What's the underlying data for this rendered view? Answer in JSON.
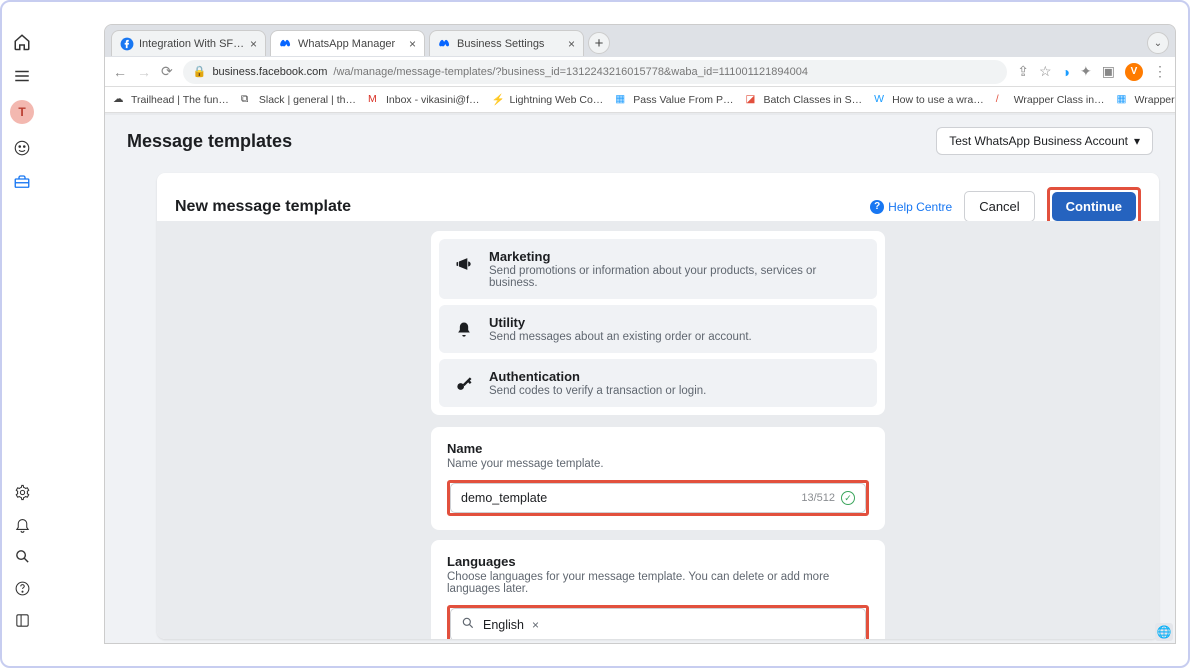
{
  "browser": {
    "tabs": [
      {
        "label": "Integration With SF - WhatsAp…"
      },
      {
        "label": "WhatsApp Manager"
      },
      {
        "label": "Business Settings"
      }
    ],
    "url_prefix": "business.facebook.com",
    "url_path": "/wa/manage/message-templates/?business_id=1312243216015778&waba_id=111001121894004",
    "avatar_letter": "V"
  },
  "bookmarks": [
    {
      "label": "Trailhead | The fun…"
    },
    {
      "label": "Slack | general | th…"
    },
    {
      "label": "Inbox - vikasini@f…"
    },
    {
      "label": "Lightning Web Co…"
    },
    {
      "label": "Pass Value From P…"
    },
    {
      "label": "Batch Classes in S…"
    },
    {
      "label": "How to use a wra…"
    },
    {
      "label": "Wrapper Class in…"
    },
    {
      "label": "Wrapper Class in…"
    }
  ],
  "leftnav": {
    "avatar_letter": "T"
  },
  "header": {
    "title": "Message templates",
    "account_label": "Test WhatsApp Business Account"
  },
  "card": {
    "title": "New message template",
    "help_label": "Help Centre",
    "cancel_label": "Cancel",
    "continue_label": "Continue"
  },
  "categories": [
    {
      "title": "Marketing",
      "desc": "Send promotions or information about your products, services or business."
    },
    {
      "title": "Utility",
      "desc": "Send messages about an existing order or account."
    },
    {
      "title": "Authentication",
      "desc": "Send codes to verify a transaction or login."
    }
  ],
  "name_section": {
    "label": "Name",
    "sub": "Name your message template.",
    "value": "demo_template",
    "counter": "13/512"
  },
  "lang_section": {
    "label": "Languages",
    "sub": "Choose languages for your message template. You can delete or add more languages later.",
    "value": "English"
  }
}
